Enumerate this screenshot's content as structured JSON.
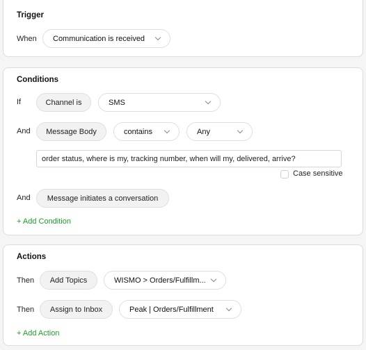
{
  "trigger": {
    "title": "Trigger",
    "when_label": "When",
    "event": "Communication is received"
  },
  "conditions": {
    "title": "Conditions",
    "if_label": "If",
    "and_label": "And",
    "channel_field": "Channel is",
    "channel_value": "SMS",
    "body_field": "Message Body",
    "operator": "contains",
    "match": "Any",
    "keywords": "order status, where is my, tracking number, when will my, delivered, arrive?",
    "case_sensitive_label": "Case sensitive",
    "case_sensitive": false,
    "initiates": "Message initiates a conversation",
    "add_label": "+ Add Condition"
  },
  "actions": {
    "title": "Actions",
    "then_label": "Then",
    "action1": "Add Topics",
    "action1_value": "WISMO > Orders/Fulfillm...",
    "action2": "Assign to Inbox",
    "action2_value": "Peak | Orders/Fulfillment",
    "add_label": "+ Add Action"
  },
  "colors": {
    "accent": "#1f9d2a"
  }
}
